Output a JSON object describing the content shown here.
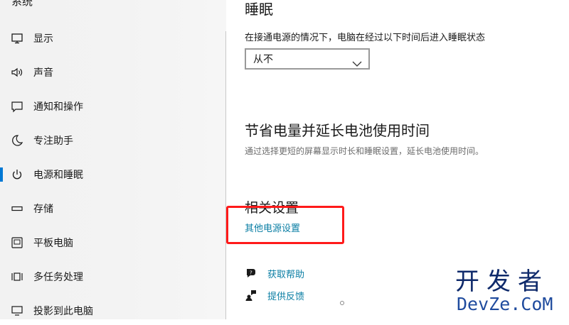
{
  "sidebar": {
    "top_cut_label": "系统",
    "items": [
      {
        "label": "显示",
        "icon": "monitor-icon"
      },
      {
        "label": "声音",
        "icon": "speaker-icon"
      },
      {
        "label": "通知和操作",
        "icon": "notification-icon"
      },
      {
        "label": "专注助手",
        "icon": "moon-icon"
      },
      {
        "label": "电源和睡眠",
        "icon": "power-icon",
        "selected": true
      },
      {
        "label": "存储",
        "icon": "storage-icon"
      },
      {
        "label": "平板电脑",
        "icon": "tablet-icon"
      },
      {
        "label": "多任务处理",
        "icon": "multitask-icon"
      },
      {
        "label": "投影到此电脑",
        "icon": "projection-icon"
      }
    ]
  },
  "main": {
    "sleep": {
      "heading": "睡眠",
      "description": "在接通电源的情况下，电脑在经过以下时间后进入睡眠状态",
      "selected_value": "从不"
    },
    "battery": {
      "heading": "节省电量并延长电池使用时间",
      "description": "通过选择更短的屏幕显示时长和睡眠设置，延长电池使用时间。"
    },
    "related": {
      "heading": "相关设置",
      "link": "其他电源设置"
    },
    "help": {
      "get_help": "获取帮助",
      "feedback": "提供反馈"
    }
  },
  "watermark": {
    "cn": "开发者",
    "en": "DevZe.CoM"
  },
  "colors": {
    "accent": "#0078d4",
    "link": "#0a7ea4",
    "highlight": "#ff1a1a"
  }
}
